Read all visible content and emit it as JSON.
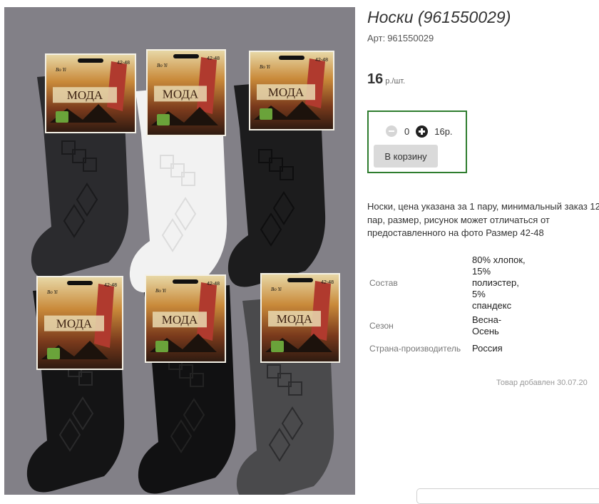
{
  "product": {
    "title": "Носки (961550029)",
    "sku_label": "Арт:",
    "sku_value": "961550029",
    "price_value": "16",
    "price_unit": "р./шт.",
    "image_alt": "Носки"
  },
  "package_label": {
    "brand": "МОДА",
    "size": "42-48",
    "maker": "Bo Yi"
  },
  "cart": {
    "quantity": "0",
    "total": "16р.",
    "add_button": "В корзину",
    "minus_icon": "minus-circle-icon",
    "plus_icon": "plus-circle-icon"
  },
  "description": "Носки, цена указана за 1 пару, минимальный заказ 12 пар, размер, рисунок может отличаться от предоставленного на фото Размер 42-48",
  "specs": [
    {
      "label": "Состав",
      "value_lines": [
        "80% хлопок,",
        "15%",
        "полиэстер,",
        "5%",
        "спандекс"
      ]
    },
    {
      "label": "Сезон",
      "value_lines": [
        "Весна-",
        "Осень"
      ]
    },
    {
      "label": "Страна-производитель",
      "value_lines": [
        "Россия"
      ]
    }
  ],
  "added_date": "Товар добавлен 30.07.20",
  "colors": {
    "image_background": "#828087",
    "cart_border": "#2e7d2e",
    "button_background": "#dadada",
    "label_red": "#b03a2e",
    "label_gold": "#c98a3a"
  }
}
